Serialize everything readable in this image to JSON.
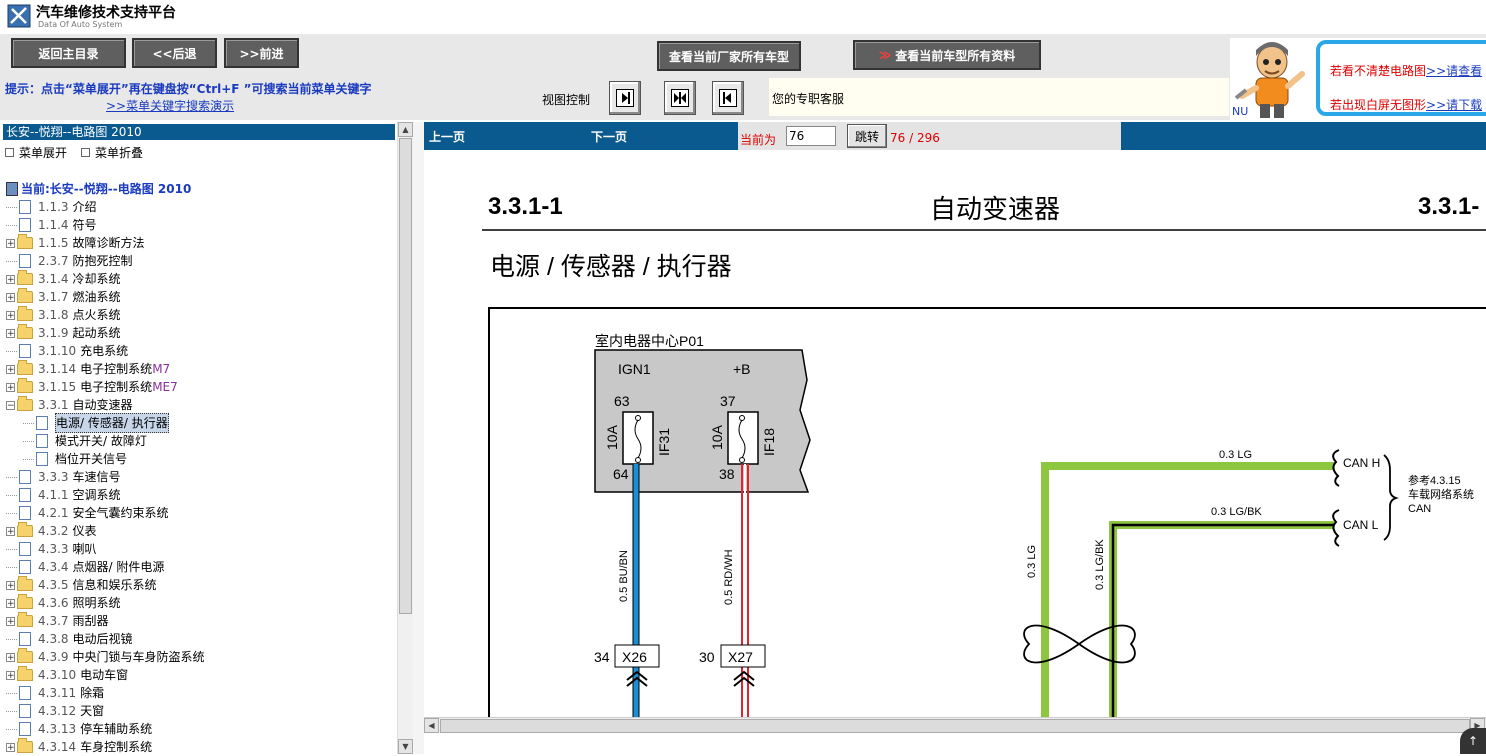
{
  "app": {
    "title": "汽车维修技术支持平台",
    "subtitle": "Data Of Auto System"
  },
  "toolbar": {
    "back_main": "返回主目录",
    "prev": "<<后退",
    "next": ">>前进",
    "view_factory_models": "查看当前厂家所有车型",
    "view_model_all_info_arrow": "≫",
    "view_model_all_info": "查看当前车型所有资料"
  },
  "hint": {
    "text": "提示：点击“菜单展开”再在键盘按“Ctrl+F ”可搜索当前菜单关键字",
    "link": ">>菜单关键字搜索演示",
    "view_control_label": "视图控制",
    "service_text": "您的专职客服"
  },
  "ad": {
    "line1": "若看不清楚电路图",
    "line1_link": ">>请查看",
    "line2": "若出现白屏无图形",
    "line2_link": ">>请下载",
    "nu": "NU"
  },
  "tree": {
    "header": "长安--悦翔--电路图 2010",
    "expand_label": "菜单展开",
    "collapse_label": "菜单折叠",
    "current": "当前:长安--悦翔--电路图 2010",
    "items": [
      {
        "num": "1.1.3",
        "label": "介绍",
        "type": "page",
        "plus": false,
        "indent": 0
      },
      {
        "num": "1.1.4",
        "label": "符号",
        "type": "page",
        "plus": false,
        "indent": 0
      },
      {
        "num": "1.1.5",
        "label": "故障诊断方法",
        "type": "folder",
        "plus": true,
        "indent": 0
      },
      {
        "num": "2.3.7",
        "label": "防抱死控制",
        "type": "page",
        "plus": false,
        "indent": 0
      },
      {
        "num": "3.1.4",
        "label": "冷却系统",
        "type": "folder",
        "plus": true,
        "indent": 0
      },
      {
        "num": "3.1.7",
        "label": "燃油系统",
        "type": "folder",
        "plus": true,
        "indent": 0
      },
      {
        "num": "3.1.8",
        "label": "点火系统",
        "type": "folder",
        "plus": true,
        "indent": 0
      },
      {
        "num": "3.1.9",
        "label": "起动系统",
        "type": "folder",
        "plus": true,
        "indent": 0
      },
      {
        "num": "3.1.10",
        "label": "充电系统",
        "type": "page",
        "plus": false,
        "indent": 0
      },
      {
        "num": "3.1.14",
        "label": "电子控制系统",
        "suffix": "M7",
        "type": "folder",
        "plus": true,
        "indent": 0
      },
      {
        "num": "3.1.15",
        "label": "电子控制系统",
        "suffix": "ME7",
        "type": "folder",
        "plus": true,
        "indent": 0
      },
      {
        "num": "3.3.1",
        "label": "自动变速器",
        "type": "folder",
        "plus": true,
        "minus": true,
        "indent": 0
      },
      {
        "num": "",
        "label": "电源/ 传感器/ 执行器",
        "type": "page",
        "plus": false,
        "indent": 1,
        "selected": true
      },
      {
        "num": "",
        "label": "模式开关/ 故障灯",
        "type": "page",
        "plus": false,
        "indent": 1
      },
      {
        "num": "",
        "label": "档位开关信号",
        "type": "page",
        "plus": false,
        "indent": 1
      },
      {
        "num": "3.3.3",
        "label": "车速信号",
        "type": "page",
        "plus": false,
        "indent": 0
      },
      {
        "num": "4.1.1",
        "label": "空调系统",
        "type": "page",
        "plus": false,
        "indent": 0
      },
      {
        "num": "4.2.1",
        "label": "安全气囊约束系统",
        "type": "page",
        "plus": false,
        "indent": 0
      },
      {
        "num": "4.3.2",
        "label": "仪表",
        "type": "folder",
        "plus": true,
        "indent": 0
      },
      {
        "num": "4.3.3",
        "label": "喇叭",
        "type": "page",
        "plus": false,
        "indent": 0
      },
      {
        "num": "4.3.4",
        "label": "点烟器/ 附件电源",
        "type": "page",
        "plus": false,
        "indent": 0
      },
      {
        "num": "4.3.5",
        "label": "信息和娱乐系统",
        "type": "folder",
        "plus": true,
        "indent": 0
      },
      {
        "num": "4.3.6",
        "label": "照明系统",
        "type": "folder",
        "plus": true,
        "indent": 0
      },
      {
        "num": "4.3.7",
        "label": "雨刮器",
        "type": "folder",
        "plus": true,
        "indent": 0
      },
      {
        "num": "4.3.8",
        "label": "电动后视镜",
        "type": "page",
        "plus": false,
        "indent": 0
      },
      {
        "num": "4.3.9",
        "label": "中央门锁与车身防盗系统",
        "type": "folder",
        "plus": true,
        "indent": 0
      },
      {
        "num": "4.3.10",
        "label": "电动车窗",
        "type": "folder",
        "plus": true,
        "indent": 0
      },
      {
        "num": "4.3.11",
        "label": "除霜",
        "type": "page",
        "plus": false,
        "indent": 0
      },
      {
        "num": "4.3.12",
        "label": "天窗",
        "type": "page",
        "plus": false,
        "indent": 0
      },
      {
        "num": "4.3.13",
        "label": "停车辅助系统",
        "type": "page",
        "plus": false,
        "indent": 0
      },
      {
        "num": "4.3.14",
        "label": "车身控制系统",
        "type": "folder",
        "plus": true,
        "indent": 0
      }
    ]
  },
  "pager": {
    "prev": "上一页",
    "next": "下一页",
    "current_label": "当前为",
    "page_value": "76",
    "jump": "跳转",
    "count": "76 / 296"
  },
  "diagram": {
    "code_left": "3.3.1-1",
    "title": "自动变速器",
    "code_right": "3.3.1-",
    "subtitle": "电源 / 传感器 / 执行器",
    "box_label": "室内电器中心P01",
    "fuse1": {
      "supply": "IGN1",
      "pin_in": "63",
      "pin_out": "64",
      "rating": "10A",
      "name": "IF31"
    },
    "fuse2": {
      "supply": "+B",
      "pin_in": "37",
      "pin_out": "38",
      "rating": "10A",
      "name": "IF18"
    },
    "wire1": "0.5 BU/BN",
    "wire2": "0.5 RD/WH",
    "conn1": {
      "pin": "34",
      "name": "X26"
    },
    "conn2": {
      "pin": "30",
      "name": "X27"
    },
    "can_h_wire": "0.3 LG",
    "can_l_wire": "0.3 LG/BK",
    "can_h_vert": "0.3 LG",
    "can_l_vert": "0.3 LG/BK",
    "can_h": "CAN H",
    "can_l": "CAN L",
    "ref1": "参考4.3.15",
    "ref2": "车载网络系统",
    "ref3": "CAN",
    "colors": {
      "blue": "#1a8fd6",
      "red": "#e8202a",
      "green": "#8dc63f"
    }
  }
}
